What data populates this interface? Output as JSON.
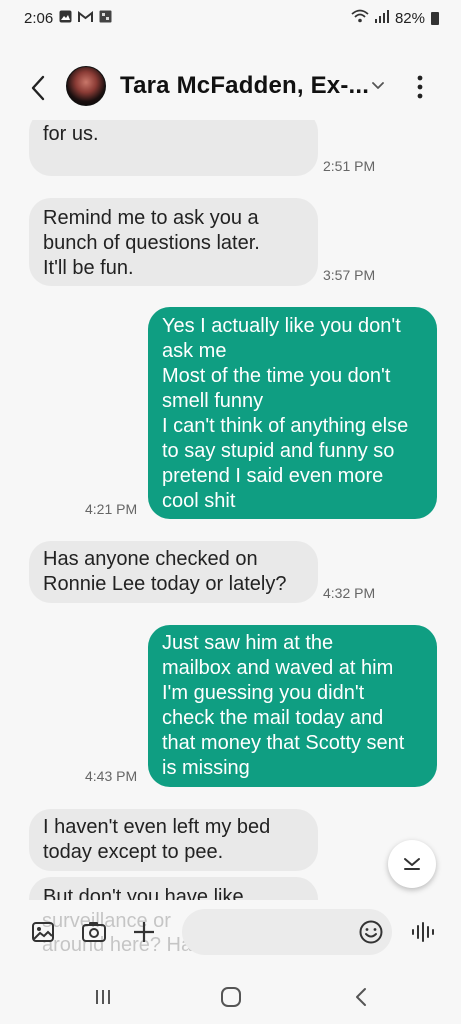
{
  "status_bar": {
    "time": "2:06",
    "battery": "82%",
    "left_icons": [
      "gallery-icon",
      "gmail-icon",
      "app-icon"
    ],
    "right_icons": [
      "wifi-icon",
      "signal-icon",
      "battery-icon"
    ]
  },
  "header": {
    "contact_name": "Tara McFadden, Ex-..."
  },
  "messages": [
    {
      "direction": "in",
      "lines": [
        "for us."
      ],
      "time": "2:51 PM"
    },
    {
      "direction": "in",
      "lines": [
        "Remind me to ask you a",
        "bunch of questions later.",
        "It'll be fun."
      ],
      "time": "3:57 PM"
    },
    {
      "direction": "out",
      "lines": [
        "Yes I actually like you don't",
        "ask me",
        "Most of the time you don't",
        "smell funny",
        "I can't think of anything else",
        "to say stupid and funny so",
        "pretend I said even more",
        "cool shit"
      ],
      "time": "4:21 PM"
    },
    {
      "direction": "in",
      "lines": [
        "Has anyone checked on",
        "Ronnie Lee today or lately?"
      ],
      "time": "4:32 PM"
    },
    {
      "direction": "out",
      "lines": [
        "Just saw him at the",
        "mailbox and waved at him",
        "I'm guessing you didn't",
        "check the mail today and",
        "that money that Scotty sent",
        "is missing"
      ],
      "time": "4:43 PM"
    },
    {
      "direction": "in",
      "lines": [
        "I haven't even left my bed",
        "today except to pee."
      ],
      "time": ""
    },
    {
      "direction": "in",
      "lines": [
        "But don't you have like",
        "surveillance or",
        "around here? Ha"
      ],
      "time": ""
    }
  ],
  "composer": {
    "placeholder": "",
    "icons": [
      "image-icon",
      "camera-icon",
      "plus-icon",
      "emoji-icon",
      "voice-icon"
    ]
  },
  "navbar": {
    "icons": [
      "recent-apps-icon",
      "home-icon",
      "back-nav-icon"
    ]
  },
  "colors": {
    "incoming_bubble": "#e9e9e9",
    "outgoing_bubble": "#0f9e82",
    "background": "#f7f7f7"
  }
}
